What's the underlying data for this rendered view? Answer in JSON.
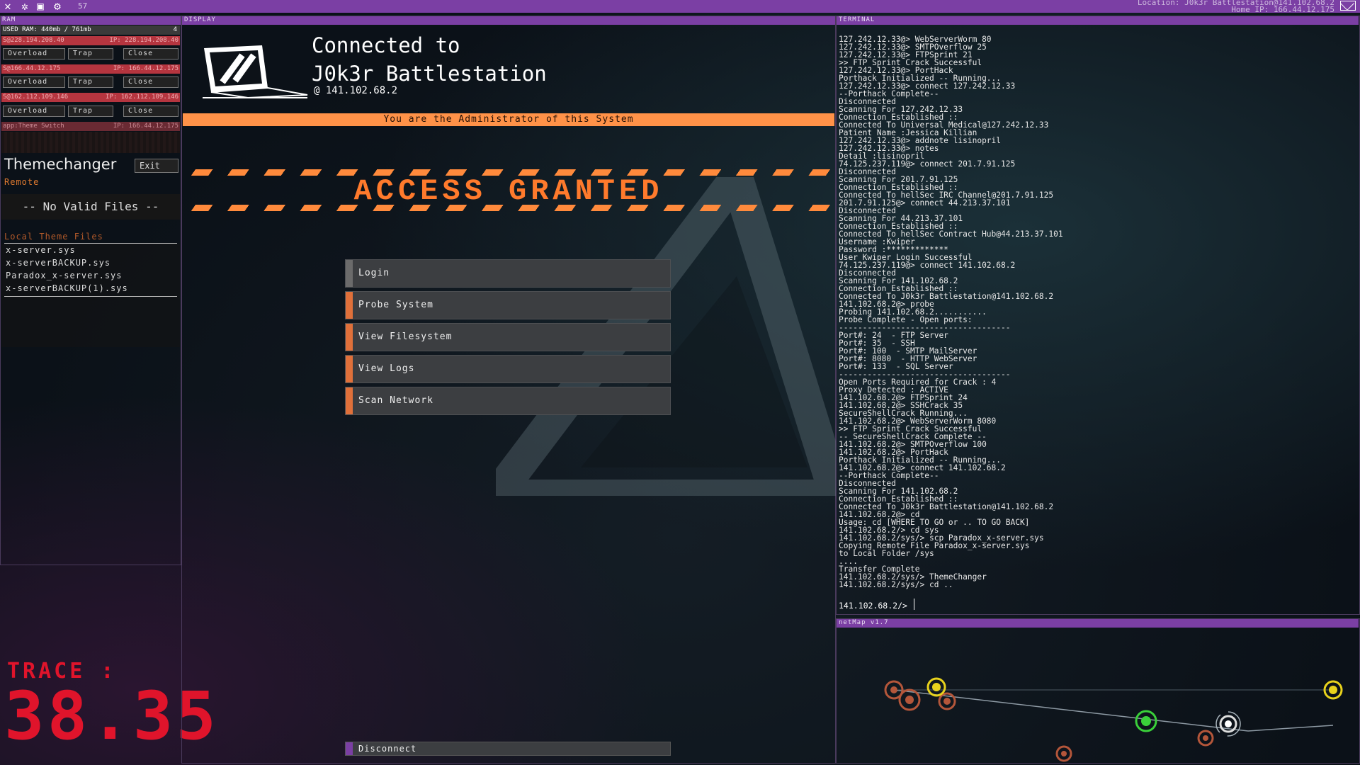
{
  "topbar": {
    "count": "57",
    "location": "Location: J0k3r Battlestation@141.102.68.2",
    "home_ip": "Home IP: 166.44.12.175"
  },
  "ram": {
    "header": "RAM",
    "usage": "USED RAM: 440mb / 761mb",
    "count": "4",
    "connections": [
      {
        "host": "S@228.194.208.40",
        "ip": "IP: 228.194.208.40"
      },
      {
        "host": "S@166.44.12.175",
        "ip": "IP: 166.44.12.175"
      },
      {
        "host": "S@162.112.109.146",
        "ip": "IP: 162.112.109.146"
      }
    ],
    "buttons": {
      "overload": "Overload",
      "trap": "Trap",
      "close": "Close"
    }
  },
  "themechanger": {
    "header": "app:Theme Switch",
    "ip": "IP: 166.44.12.175",
    "title": "Themechanger",
    "exit": "Exit",
    "remote": "Remote",
    "no_files": "-- No Valid Files --",
    "local_label": "Local Theme Files",
    "files": [
      "x-server.sys",
      "x-serverBACKUP.sys",
      "Paradox_x-server.sys",
      "x-serverBACKUP(1).sys"
    ]
  },
  "trace": {
    "label": "TRACE :",
    "value": "38.35"
  },
  "display": {
    "header": "DISPLAY",
    "connected_line1": "Connected to",
    "connected_line2": "J0k3r Battlestation",
    "ip": "@  141.102.68.2",
    "admin": "You are the Administrator of this System",
    "access": "ACCESS GRANTED",
    "menu": [
      {
        "label": "Login",
        "accent": "#6b6b6b"
      },
      {
        "label": "Probe System",
        "accent": "#e0703a"
      },
      {
        "label": "View Filesystem",
        "accent": "#e0703a"
      },
      {
        "label": "View Logs",
        "accent": "#e0703a"
      },
      {
        "label": "Scan Network",
        "accent": "#e0703a"
      }
    ],
    "disconnect": "Disconnect"
  },
  "terminal": {
    "header": "TERMINAL",
    "lines": [
      "127.242.12.33@> WebServerWorm 80",
      "127.242.12.33@> SMTPOverflow 25",
      "127.242.12.33@> FTPSprint 21",
      ">> FTP Sprint Crack Successful",
      "127.242.12.33@> PortHack",
      "Porthack Initialized -- Running...",
      "127.242.12.33@> connect 127.242.12.33",
      "--Porthack Complete--",
      "Disconnected",
      "Scanning For 127.242.12.33",
      "Connection Established ::",
      "Connected To Universal Medical@127.242.12.33",
      "Patient Name :Jessica Killian",
      "127.242.12.33@> addnote lisinopril",
      "127.242.12.33@> notes",
      "Detail :lisinopril",
      "74.125.237.119@> connect 201.7.91.125",
      "Disconnected",
      "Scanning For 201.7.91.125",
      "Connection Established ::",
      "Connected To hellSec IRC Channel@201.7.91.125",
      "201.7.91.125@> connect 44.213.37.101",
      "Disconnected",
      "Scanning For 44.213.37.101",
      "Connection Established ::",
      "Connected To hellSec Contract Hub@44.213.37.101",
      "Username :Kwiper",
      "Password :*************",
      "User Kwiper Login Successful",
      "74.125.237.119@> connect 141.102.68.2",
      "Disconnected",
      "Scanning For 141.102.68.2",
      "Connection Established ::",
      "Connected To J0k3r Battlestation@141.102.68.2",
      "141.102.68.2@> probe",
      "Probing 141.102.68.2...........",
      "Probe Complete - Open ports:",
      "------------------------------------",
      "Port#: 24  - FTP Server",
      "Port#: 35  - SSH",
      "Port#: 100  - SMTP MailServer",
      "Port#: 8080  - HTTP WebServer",
      "Port#: 133  - SQL Server",
      "------------------------------------",
      "Open Ports Required for Crack : 4",
      "Proxy Detected : ACTIVE",
      "141.102.68.2@> FTPSprint 24",
      "141.102.68.2@> SSHCrack 35",
      "SecureShellCrack Running...",
      "141.102.68.2@> WebServerWorm 8080",
      ">> FTP Sprint Crack Successful",
      "-- SecureShellCrack Complete --",
      "141.102.68.2@> SMTPOverflow 100",
      "141.102.68.2@> PortHack",
      "Porthack Initialized -- Running...",
      "141.102.68.2@> connect 141.102.68.2",
      "--Porthack Complete--",
      "Disconnected",
      "Scanning For 141.102.68.2",
      "Connection Established ::",
      "Connected To J0k3r Battlestation@141.102.68.2",
      "141.102.68.2@> cd",
      "Usage: cd [WHERE TO GO or .. TO GO BACK]",
      "141.102.68.2/> cd sys",
      "141.102.68.2/sys/> scp Paradox_x-server.sys",
      "Copying Remote File Paradox_x-server.sys",
      "to Local Folder /sys",
      "....",
      "Transfer Complete",
      "141.102.68.2/sys/> ThemeChanger",
      "141.102.68.2/sys/> cd .."
    ],
    "prompt": "141.102.68.2/>"
  },
  "netmap": {
    "header": "netMap v1.7"
  },
  "colors": {
    "purple": "#7b3fa4",
    "orange": "#ff8a3c",
    "trace_red": "#e0142b",
    "node_yellow": "#e8d21c",
    "node_green": "#3ad03a",
    "node_orange": "#b4563a"
  }
}
